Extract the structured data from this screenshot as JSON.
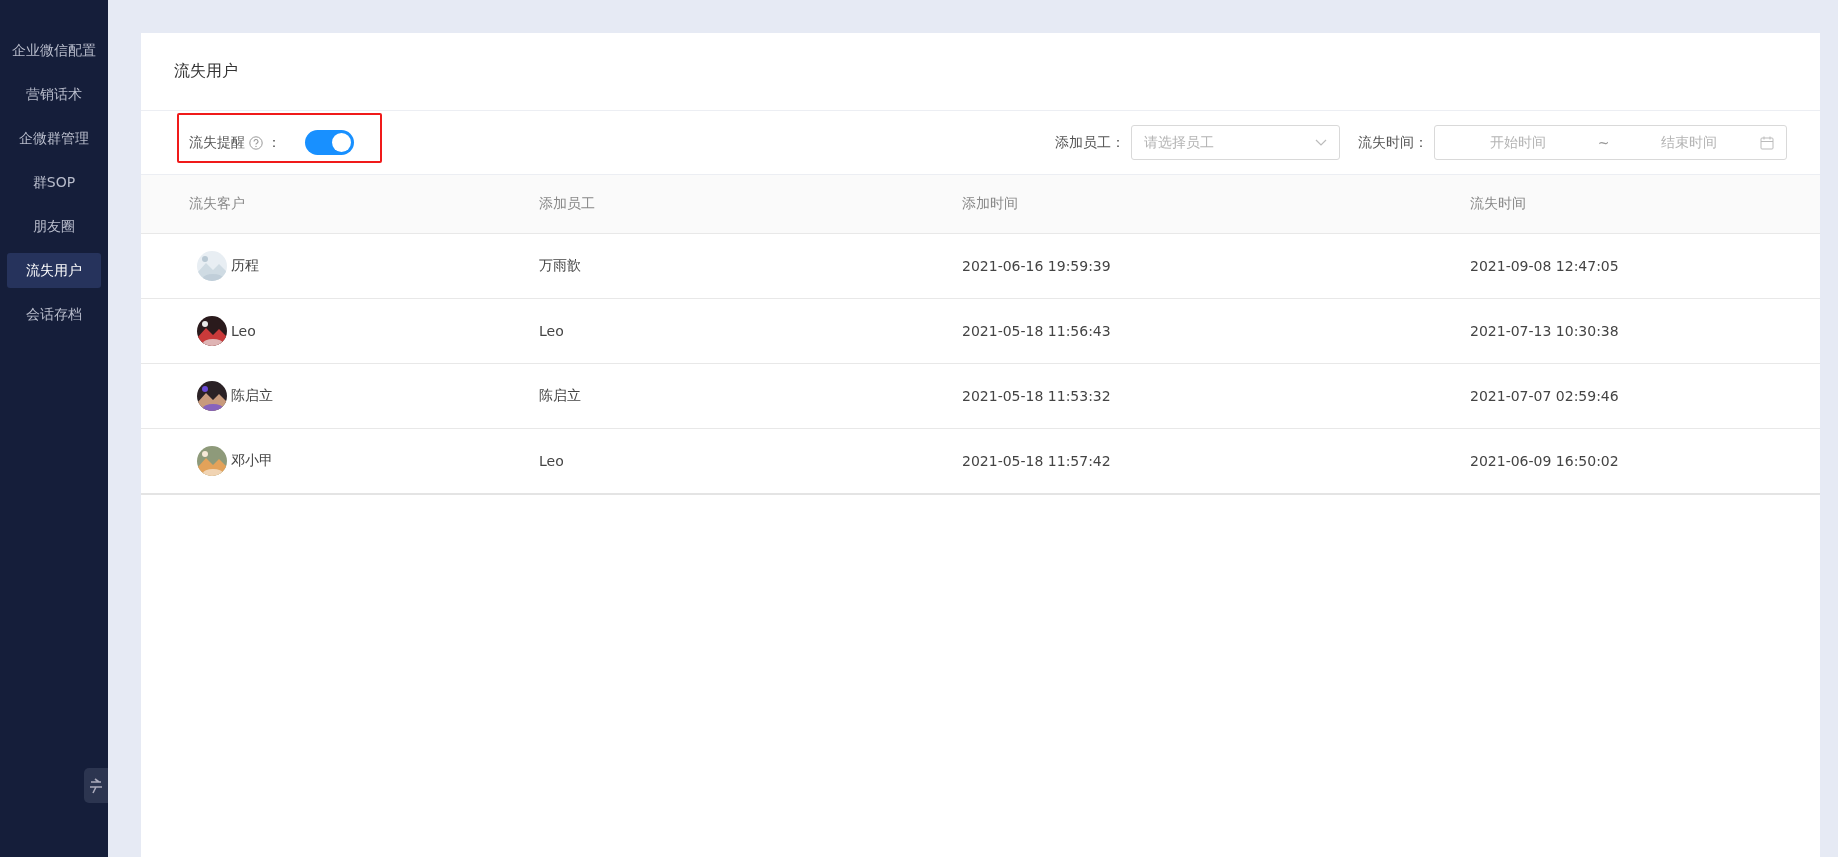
{
  "sidebar": {
    "items": [
      {
        "label": "企业微信配置",
        "selected": false
      },
      {
        "label": "营销话术",
        "selected": false
      },
      {
        "label": "企微群管理",
        "selected": false
      },
      {
        "label": "群SOP",
        "selected": false
      },
      {
        "label": "朋友圈",
        "selected": false
      },
      {
        "label": "流失用户",
        "selected": true
      },
      {
        "label": "会话存档",
        "selected": false
      }
    ]
  },
  "page": {
    "title": "流失用户"
  },
  "filters": {
    "churn_reminder": {
      "label": "流失提醒",
      "colon": "：",
      "on": true
    },
    "staff": {
      "label": "添加员工：",
      "placeholder": "请选择员工"
    },
    "churn_time": {
      "label": "流失时间：",
      "start_placeholder": "开始时间",
      "separator": "~",
      "end_placeholder": "结束时间"
    }
  },
  "table": {
    "columns": [
      "流失客户",
      "添加员工",
      "添加时间",
      "流失时间"
    ],
    "rows": [
      {
        "customer": "历程",
        "staff": "万雨歆",
        "added": "2021-06-16 19:59:39",
        "churned": "2021-09-08 12:47:05"
      },
      {
        "customer": "Leo",
        "staff": "Leo",
        "added": "2021-05-18 11:56:43",
        "churned": "2021-07-13 10:30:38"
      },
      {
        "customer": "陈启立",
        "staff": "陈启立",
        "added": "2021-05-18 11:53:32",
        "churned": "2021-07-07 02:59:46"
      },
      {
        "customer": "邓小甲",
        "staff": "Leo",
        "added": "2021-05-18 11:57:42",
        "churned": "2021-06-09 16:50:02"
      }
    ]
  }
}
